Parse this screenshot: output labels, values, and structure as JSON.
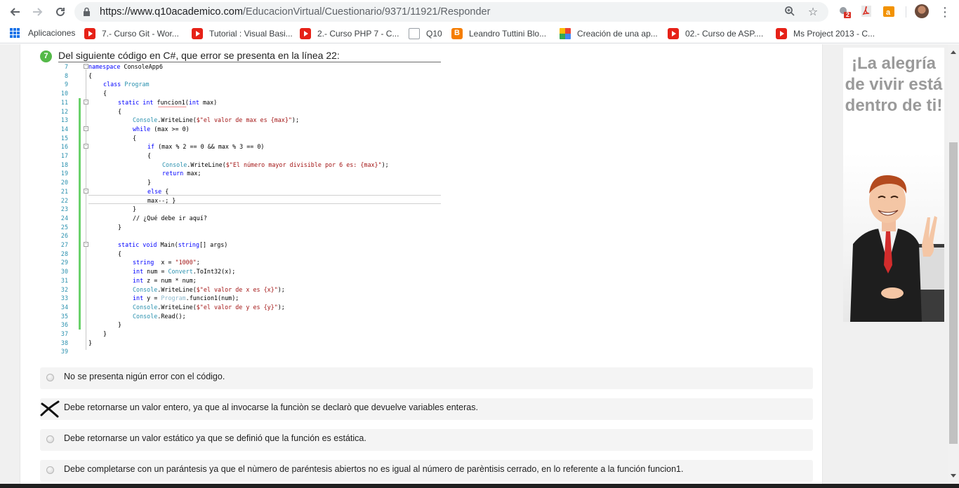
{
  "browser": {
    "url_host": "https://www.q10academico.com",
    "url_path": "/EducacionVirtual/Cuestionario/9371/11921/Responder",
    "ext_badge": "2",
    "bookmarks": [
      {
        "label": "Aplicaciones",
        "icon": "apps-grid-icon"
      },
      {
        "label": "7.- Curso Git - Wor...",
        "icon": "youtube-icon"
      },
      {
        "label": "Tutorial : Visual Basi...",
        "icon": "youtube-icon"
      },
      {
        "label": "2.- Curso PHP 7 - C...",
        "icon": "youtube-icon"
      },
      {
        "label": "Q10",
        "icon": "document-icon"
      },
      {
        "label": "Leandro Tuttini Blo...",
        "icon": "blogger-icon"
      },
      {
        "label": "Creación de una ap...",
        "icon": "microsoft-icon"
      },
      {
        "label": "02.- Curso de ASP....",
        "icon": "youtube-icon"
      },
      {
        "label": "Ms Project 2013 - C...",
        "icon": "youtube-icon"
      }
    ]
  },
  "question": {
    "number": "7",
    "text": "Del siguiente código en C#, que error se presenta en la línea 22:",
    "line_numbers": [
      "7",
      "8",
      "9",
      "10",
      "11",
      "12",
      "13",
      "14",
      "15",
      "16",
      "17",
      "18",
      "19",
      "20",
      "21",
      "22",
      "23",
      "24",
      "25",
      "26",
      "27",
      "28",
      "29",
      "30",
      "31",
      "32",
      "33",
      "34",
      "35",
      "36",
      "37",
      "38",
      "39"
    ],
    "code": {
      "l7_kw": "namespace",
      "l7_name": " ConsoleApp6",
      "l8": "{",
      "l9_kw": "class",
      "l9_name": " Program",
      "l10": "{",
      "l11_kw": "static int",
      "l11_fn": " funcion1(",
      "l11_kw2": "int",
      "l11_end": " max)",
      "l12": "{",
      "l13_cls": "Console",
      "l13_mid": ".WriteLine(",
      "l13_str": "$\"el valor de max es {max}\"",
      "l13_end": ");",
      "l14_kw": "while",
      "l14_end": " (max >= 0)",
      "l15": "{",
      "l16_kw": "if",
      "l16_end": " (max % 2 == 0 && max % 3 == 0)",
      "l17": "{",
      "l18_cls": "Console",
      "l18_mid": ".WriteLine(",
      "l18_str": "$\"El número mayor divisible por 6 es: {max}\"",
      "l18_end": ");",
      "l19_kw": "return",
      "l19_end": " max;",
      "l20": "}",
      "l21_kw": "else",
      "l21_end": " {",
      "l22": "max--; }",
      "l23": "}",
      "l24_cmt": "// ¿Qué debe ir aquí?",
      "l25": "}",
      "l27_kw": "static void",
      "l27_fn": " Main(",
      "l27_kw2": "string",
      "l27_end": "[] args)",
      "l28": "{",
      "l29_kw": "string",
      "l29_mid": "  x = ",
      "l29_str": "\"1000\"",
      "l29_end": ";",
      "l30_kw": "int",
      "l30_mid": " num = ",
      "l30_cls": "Convert",
      "l30_end": ".ToInt32(x);",
      "l31_kw": "int",
      "l31_end": " z = num * num;",
      "l32_cls": "Console",
      "l32_mid": ".WriteLine(",
      "l32_str": "$\"el valor de x es {x}\"",
      "l32_end": ");",
      "l33_kw": "int",
      "l33_mid": " y = ",
      "l33_cls": "Program",
      "l33_end": ".funcion1(num);",
      "l34_cls": "Console",
      "l34_mid": ".WriteLine(",
      "l34_str": "$\"el valor de y es {y}\"",
      "l34_end": ");",
      "l35_cls": "Console",
      "l35_end": ".Read();",
      "l36": "}",
      "l37": "}",
      "l38": "}"
    }
  },
  "answers": [
    {
      "label": "No se presenta nigún error con el código.",
      "state": "radio"
    },
    {
      "label": "Debe retornarse un valor entero, ya que al invocarse la funciòn se declarò que devuelve variables enteras.",
      "state": "marked-x"
    },
    {
      "label": "Debe retornarse un valor estático ya que se definió que la función es estática.",
      "state": "radio"
    },
    {
      "label": "Debe completarse con un parántesis ya que el nùmero de paréntesis abiertos no es igual al número de parèntisis cerrado, en lo referente a la función funcion1.",
      "state": "radio"
    }
  ],
  "ad": {
    "headline": "¡La alegría de vivir está dentro de ti!"
  },
  "colors": {
    "keyword": "#0000ff",
    "string": "#a31515",
    "class": "#2b91af",
    "comment": "#008000",
    "question_badge": "#54b948"
  }
}
